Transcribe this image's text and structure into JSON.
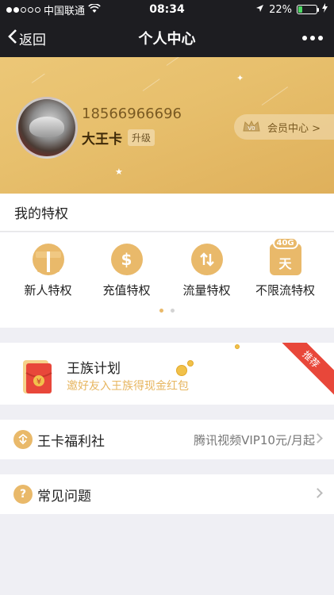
{
  "status_bar": {
    "carrier": "中国联通",
    "time": "08:34",
    "battery": "22%",
    "battery_level": 0.22
  },
  "nav": {
    "back_label": "返回",
    "title": "个人中心"
  },
  "profile": {
    "phone": "18566966696",
    "card_name": "大王卡",
    "upgrade_label": "升级",
    "member_center": "会员中心 >",
    "vip_badge": "V0"
  },
  "privileges": {
    "title": "我的特权",
    "items": [
      {
        "label": "新人特权",
        "icon": "gift-icon"
      },
      {
        "label": "充值特权",
        "icon": "dollar-icon"
      },
      {
        "label": "流量特权",
        "icon": "updown-arrows-icon"
      },
      {
        "label": "不限流特权",
        "icon": "unlimited-40g-icon",
        "badge": "40G",
        "glyph": "天"
      }
    ],
    "page_dots": 2,
    "active_dot": 0
  },
  "promo": {
    "title": "王族计划",
    "subtitle": "邀好友入王族得现金红包",
    "ribbon": "推荐"
  },
  "rows": [
    {
      "label": "王卡福利社",
      "right": "腾讯视频VIP10元/月起",
      "icon": "welfare-icon"
    },
    {
      "label": "常见问题",
      "right": "",
      "icon": "question-icon",
      "glyph": "?"
    }
  ],
  "colors": {
    "gold": "#e7bf6c",
    "accent": "#e9b96a",
    "ribbon": "#e8473a",
    "dark": "#1d1d21"
  }
}
